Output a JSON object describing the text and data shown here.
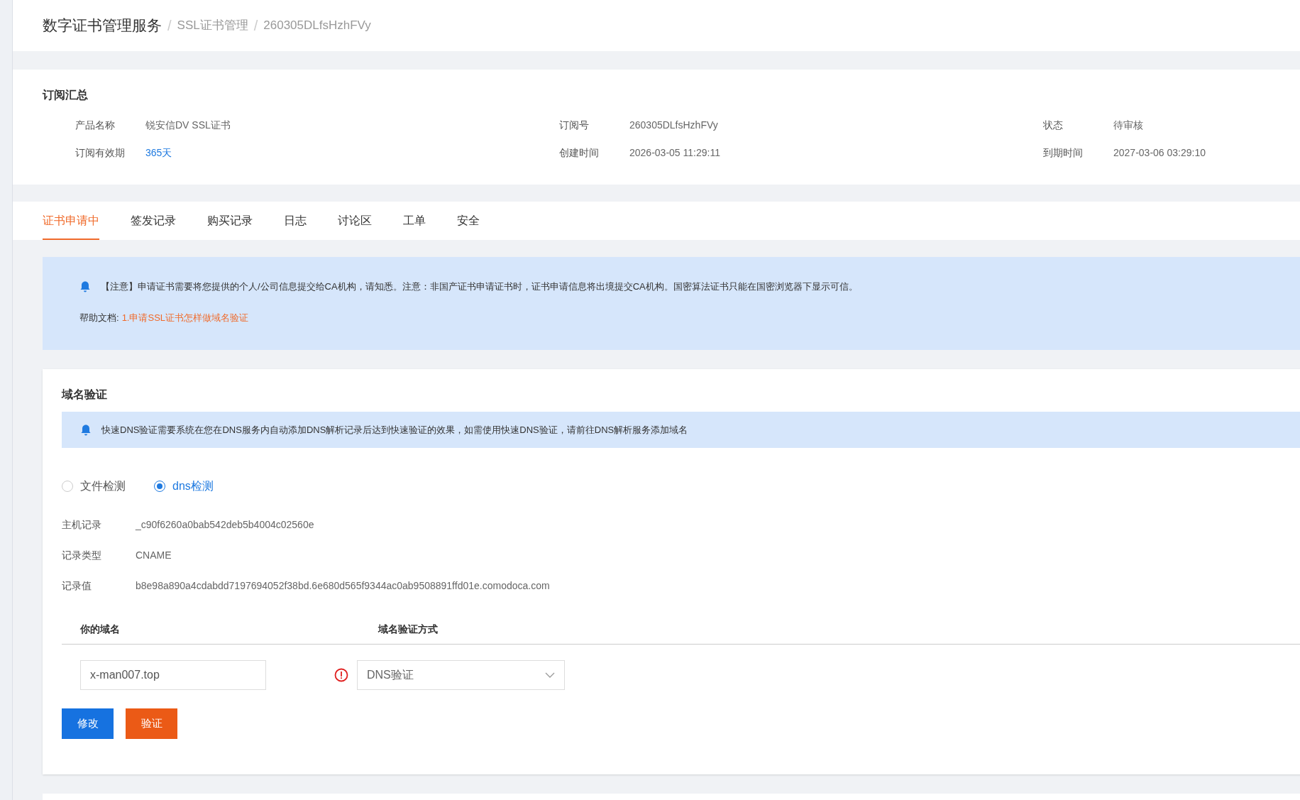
{
  "breadcrumb": [
    "数字证书管理服务",
    "SSL证书管理",
    "260305DLfsHzhFVy"
  ],
  "breadcrumb_separator": "/",
  "summary": {
    "title": "订阅汇总",
    "fields": [
      {
        "label": "产品名称",
        "value": "锐安信DV SSL证书",
        "kind": "text"
      },
      {
        "label": "订阅号",
        "value": "260305DLfsHzhFVy",
        "kind": "text"
      },
      {
        "label": "状态",
        "value": "待审核",
        "kind": "text"
      },
      {
        "label": "订阅有效期",
        "value": "365天",
        "kind": "link"
      },
      {
        "label": "创建时间",
        "value": "2026-03-05 11:29:11",
        "kind": "text"
      },
      {
        "label": "到期时间",
        "value": "2027-03-06 03:29:10",
        "kind": "text"
      }
    ]
  },
  "tabs": [
    {
      "label": "证书申请中",
      "selected": true
    },
    {
      "label": "签发记录",
      "selected": false
    },
    {
      "label": "购买记录",
      "selected": false
    },
    {
      "label": "日志",
      "selected": false
    },
    {
      "label": "讨论区",
      "selected": false
    },
    {
      "label": "工单",
      "selected": false
    },
    {
      "label": "安全",
      "selected": false
    }
  ],
  "notice": {
    "text": "【注意】申请证书需要将您提供的个人/公司信息提交给CA机构，请知悉。注意：非国产证书申请证书时，证书申请信息将出境提交CA机构。国密算法证书只能在国密浏览器下显示可信。",
    "help_label": "帮助文档:",
    "help_link": "1.申请SSL证书怎样做域名验证"
  },
  "domain_verification": {
    "title": "域名验证",
    "tip": "快速DNS验证需要系统在您在DNS服务内自动添加DNS解析记录后达到快速验证的效果，如需使用快速DNS验证，请前往DNS解析服务添加域名",
    "methods": [
      {
        "label": "文件检测",
        "selected": false
      },
      {
        "label": "dns检测",
        "selected": true
      }
    ],
    "records": [
      {
        "label": "主机记录",
        "value": "_c90f6260a0bab542deb5b4004c02560e"
      },
      {
        "label": "记录类型",
        "value": "CNAME"
      },
      {
        "label": "记录值",
        "value": "b8e98a890a4cdabdd7197694052f38bd.6e680d565f9344ac0ab9508891ffd01e.comodoca.com"
      }
    ],
    "columns": [
      "你的域名",
      "域名验证方式"
    ],
    "domain": "x-man007.top",
    "method": "DNS验证",
    "buttons": [
      {
        "label": "修改",
        "kind": "primary"
      },
      {
        "label": "验证",
        "kind": "danger"
      }
    ]
  }
}
